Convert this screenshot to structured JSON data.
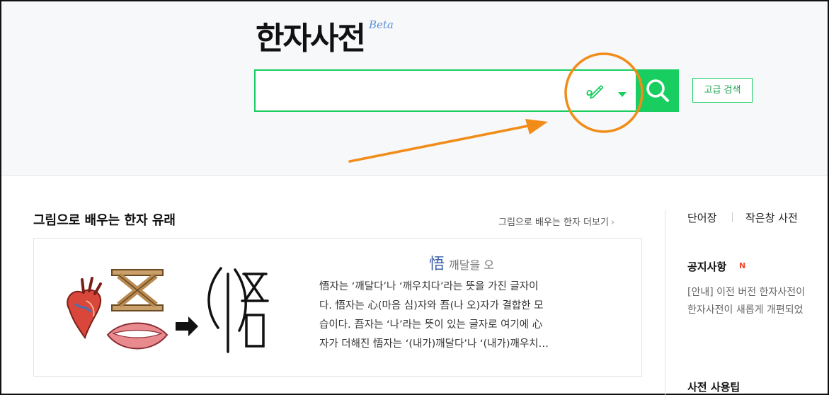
{
  "header": {
    "logo": "한자사전",
    "beta": "Beta",
    "search": {
      "value": "",
      "placeholder": ""
    },
    "handwrite_icon": "handwriting-pen-icon",
    "dropdown_icon": "triangle-down-icon",
    "search_icon": "magnifier-icon",
    "advanced_search_label": "고급 검색"
  },
  "main": {
    "section_title": "그림으로 배우는 한자 유래",
    "more_link": "그림으로 배우는 한자 더보기",
    "card": {
      "hanja": "悟",
      "meaning": "깨달을 오",
      "description_lines": [
        "悟자는 ‘깨달다’나 ‘깨우치다’라는 뜻을 가진 글자이",
        "다. 悟자는 心(마음 심)자와 吾(나 오)자가 결합한 모",
        "습이다. 吾자는 ‘나’라는 뜻이 있는 글자로 여기에 心",
        "자가 더해진 悟자는 ‘(내가)깨달다’나 ‘(내가)깨우치…"
      ]
    }
  },
  "side": {
    "links": [
      "단어장",
      "작은창 사전"
    ],
    "notice_title": "공지사항",
    "new_badge": "N",
    "notice_lines": [
      "[안내] 이전 버전 한자사전이",
      "한자사전이 새롭게 개편되었"
    ],
    "tips_title": "사전 사용팁"
  },
  "colors": {
    "accent": "#19ce60",
    "annotation": "#f28c18",
    "hanja": "#3b5fa6",
    "new_badge": "#f2452c"
  }
}
